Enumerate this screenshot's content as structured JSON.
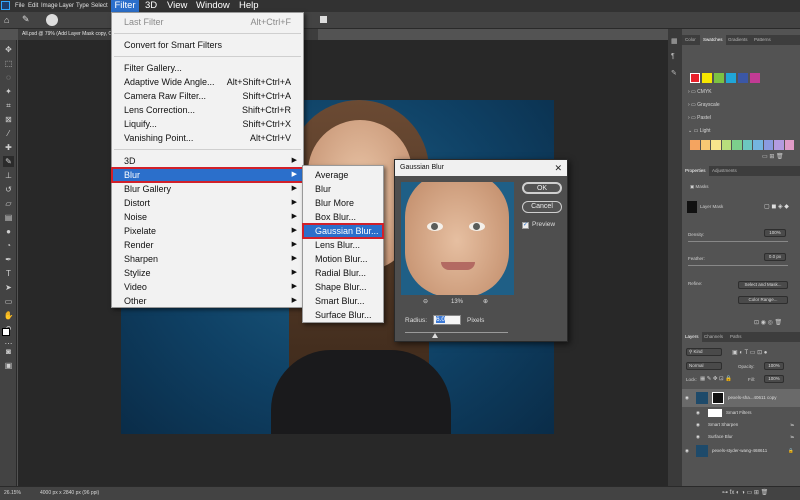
{
  "menubar": {
    "items": [
      {
        "label": "File"
      },
      {
        "label": "Edit"
      },
      {
        "label": "Image"
      },
      {
        "label": "Layer"
      },
      {
        "label": "Type"
      },
      {
        "label": "Select"
      },
      {
        "label": "Filter"
      },
      {
        "label": "3D"
      },
      {
        "label": "View"
      },
      {
        "label": "Window"
      },
      {
        "label": "Help"
      }
    ]
  },
  "document": {
    "tab_title": "All.psd @ 79% (Add Layer Mask copy, CM",
    "status_zoom": "26.15%",
    "status_info": "4000 px x 2840 px (96 ppi)"
  },
  "filter_menu": {
    "last_filter": {
      "label": "Last Filter",
      "shortcut": "Alt+Ctrl+F"
    },
    "convert": {
      "label": "Convert for Smart Filters"
    },
    "gallery": {
      "label": "Filter Gallery..."
    },
    "adaptive": {
      "label": "Adaptive Wide Angle...",
      "shortcut": "Alt+Shift+Ctrl+A"
    },
    "camera_raw": {
      "label": "Camera Raw Filter...",
      "shortcut": "Shift+Ctrl+A"
    },
    "lens": {
      "label": "Lens Correction...",
      "shortcut": "Shift+Ctrl+R"
    },
    "liquify": {
      "label": "Liquify...",
      "shortcut": "Shift+Ctrl+X"
    },
    "vanishing": {
      "label": "Vanishing Point...",
      "shortcut": "Alt+Ctrl+V"
    },
    "groups": [
      {
        "label": "3D"
      },
      {
        "label": "Blur"
      },
      {
        "label": "Blur Gallery"
      },
      {
        "label": "Distort"
      },
      {
        "label": "Noise"
      },
      {
        "label": "Pixelate"
      },
      {
        "label": "Render"
      },
      {
        "label": "Sharpen"
      },
      {
        "label": "Stylize"
      },
      {
        "label": "Video"
      },
      {
        "label": "Other"
      }
    ]
  },
  "blur_submenu": {
    "items": [
      {
        "label": "Average"
      },
      {
        "label": "Blur"
      },
      {
        "label": "Blur More"
      },
      {
        "label": "Box Blur..."
      },
      {
        "label": "Gaussian Blur..."
      },
      {
        "label": "Lens Blur..."
      },
      {
        "label": "Motion Blur..."
      },
      {
        "label": "Radial Blur..."
      },
      {
        "label": "Shape Blur..."
      },
      {
        "label": "Smart Blur..."
      },
      {
        "label": "Surface Blur..."
      }
    ]
  },
  "gaussian_dialog": {
    "title": "Gaussian Blur",
    "ok_label": "OK",
    "cancel_label": "Cancel",
    "preview_label": "Preview",
    "preview_checked": true,
    "zoom": "13%",
    "radius_label": "Radius:",
    "radius_value": "6.0",
    "radius_unit": "Pixels"
  },
  "panels": {
    "swatch_tabs": [
      "Color",
      "Swatches",
      "Gradients",
      "Patterns"
    ],
    "swatch_colors": [
      "#e8202a",
      "#f6e700",
      "#7cc242",
      "#20a6d8",
      "#3b57a6",
      "#c23b94"
    ],
    "swatch_folders": [
      "CMYK",
      "Grayscale",
      "Pastel",
      "Light"
    ],
    "light_colors": [
      "#f4a460",
      "#f7c873",
      "#f8e58c",
      "#b8dd7c",
      "#7ccf8c",
      "#6cc7c0",
      "#74b5e0",
      "#8a9be0",
      "#b39be0",
      "#e09bc7"
    ],
    "properties_tabs": [
      "Properties",
      "Adjustments"
    ],
    "masks_label": "Masks",
    "layer_mask_label": "Layer Mask",
    "density_label": "Density:",
    "density_value": "100%",
    "feather_label": "Feather:",
    "feather_value": "0.0 px",
    "refine_label": "Refine:",
    "select_mask_label": "Select and Mask...",
    "color_range_label": "Color Range...",
    "layers_tabs": [
      "Layers",
      "Channels",
      "Paths"
    ],
    "kind_label": "Kind",
    "blend_mode": "Normal",
    "opacity_label": "Opacity:",
    "opacity_value": "100%",
    "lock_label": "Lock:",
    "fill_label": "Fill:",
    "fill_value": "100%",
    "layers": [
      {
        "name": "pexels-sha...40611 copy"
      },
      {
        "name": "Smart Filters"
      },
      {
        "name": "Smart Sharpen"
      },
      {
        "name": "Surface Blur"
      },
      {
        "name": "pexels-styder-wang-468611"
      }
    ]
  }
}
